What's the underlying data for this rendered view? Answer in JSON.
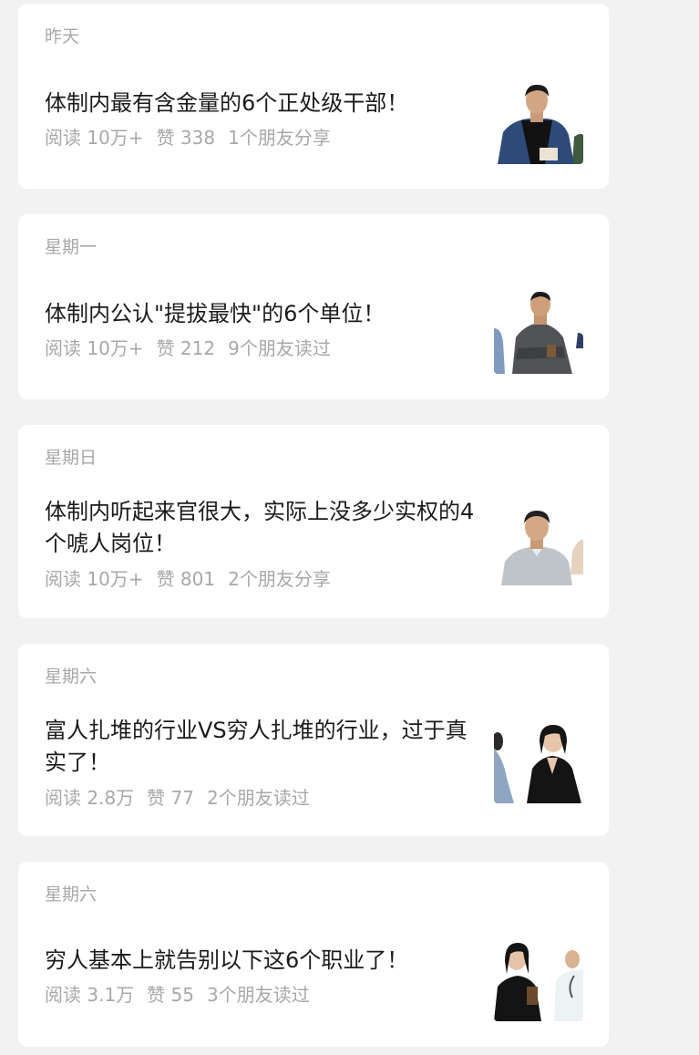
{
  "articles": [
    {
      "date": "昨天",
      "title": "体制内最有含金量的6个正处级干部！",
      "reads": "阅读 10万+",
      "likes": "赞 338",
      "social": "1个朋友分享",
      "thumbnail": "man-in-blue-suit-illustration"
    },
    {
      "date": "星期一",
      "title": "体制内公认\"提拔最快\"的6个单位！",
      "reads": "阅读 10万+",
      "likes": "赞 212",
      "social": "9个朋友读过",
      "thumbnail": "man-in-grey-jacket-arms-crossed-illustration"
    },
    {
      "date": "星期日",
      "title": "体制内听起来官很大，实际上没多少实权的4个唬人岗位！",
      "reads": "阅读 10万+",
      "likes": "赞 801",
      "social": "2个朋友分享",
      "thumbnail": "older-man-grey-shirt-illustration"
    },
    {
      "date": "星期六",
      "title": "富人扎堆的行业VS穷人扎堆的行业，过于真实了！",
      "reads": "阅读 2.8万",
      "likes": "赞 77",
      "social": "2个朋友读过",
      "thumbnail": "woman-in-black-suit-illustration"
    },
    {
      "date": "星期六",
      "title": "穷人基本上就告别以下这6个职业了！",
      "reads": "阅读 3.1万",
      "likes": "赞 55",
      "social": "3个朋友读过",
      "thumbnail": "woman-and-doctor-illustration"
    }
  ]
}
